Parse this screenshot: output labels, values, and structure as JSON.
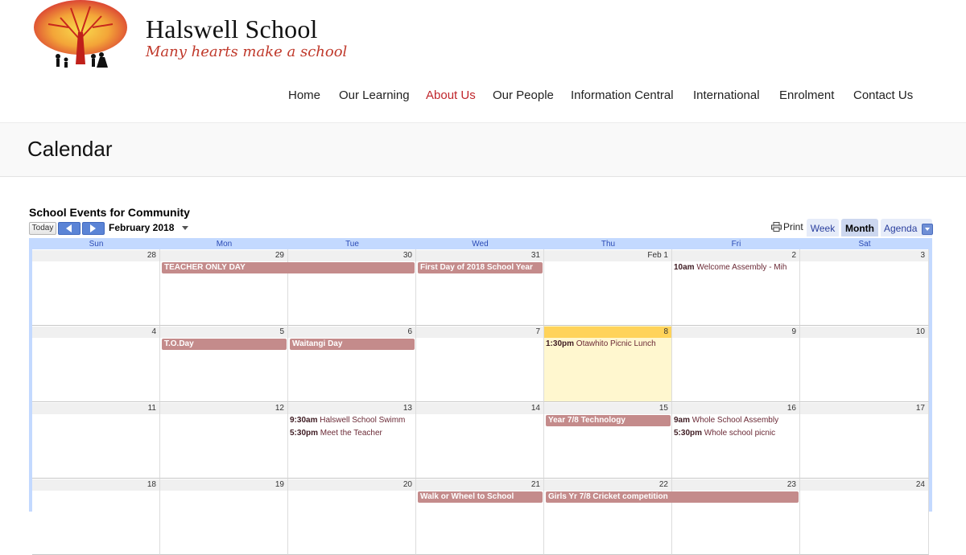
{
  "brand": {
    "name": "Halswell School",
    "tagline": "Many hearts make a school"
  },
  "nav": {
    "items": [
      "Home",
      "Our Learning",
      "About Us",
      "Our People",
      "Information Central",
      "International",
      "Enrolment",
      "Contact Us"
    ],
    "active": "About Us",
    "active_color": "#c0262c"
  },
  "page": {
    "title": "Calendar"
  },
  "calendar": {
    "title": "School Events for Community",
    "today_label": "Today",
    "month_label": "February 2018",
    "print_label": "Print",
    "views": [
      "Week",
      "Month",
      "Agenda"
    ],
    "selected_view": "Month",
    "weekdays": [
      "Sun",
      "Mon",
      "Tue",
      "Wed",
      "Thu",
      "Fri",
      "Sat"
    ],
    "weeks": [
      [
        "28",
        "29",
        "30",
        "31",
        "Feb 1",
        "2",
        "3"
      ],
      [
        "4",
        "5",
        "6",
        "7",
        "8",
        "9",
        "10"
      ],
      [
        "11",
        "12",
        "13",
        "14",
        "15",
        "16",
        "17"
      ],
      [
        "18",
        "19",
        "20",
        "21",
        "22",
        "23",
        "24"
      ]
    ],
    "today_week": 1,
    "today_day": 4,
    "event_color": "#c48b8b",
    "events": [
      {
        "week": 0,
        "day": 1,
        "span": 2,
        "bar": true,
        "title": "TEACHER ONLY DAY"
      },
      {
        "week": 0,
        "day": 3,
        "span": 1,
        "bar": true,
        "title": "First Day of 2018 School Year"
      },
      {
        "week": 0,
        "day": 5,
        "span": 1,
        "row": 0,
        "bar": false,
        "time": "10am",
        "title": "Welcome Assembly - Mih"
      },
      {
        "week": 1,
        "day": 1,
        "span": 1,
        "bar": true,
        "title": "T.O.Day"
      },
      {
        "week": 1,
        "day": 2,
        "span": 1,
        "bar": true,
        "title": "Waitangi Day"
      },
      {
        "week": 1,
        "day": 4,
        "span": 1,
        "row": 0,
        "bar": false,
        "time": "1:30pm",
        "title": "Otawhito Picnic Lunch"
      },
      {
        "week": 2,
        "day": 2,
        "span": 1,
        "row": 0,
        "bar": false,
        "time": "9:30am",
        "title": "Halswell School Swimm"
      },
      {
        "week": 2,
        "day": 2,
        "span": 1,
        "row": 1,
        "bar": false,
        "time": "5:30pm",
        "title": "Meet the Teacher"
      },
      {
        "week": 2,
        "day": 4,
        "span": 1,
        "bar": true,
        "title": "Year 7/8 Technology"
      },
      {
        "week": 2,
        "day": 5,
        "span": 1,
        "row": 0,
        "bar": false,
        "time": "9am",
        "title": "Whole School Assembly"
      },
      {
        "week": 2,
        "day": 5,
        "span": 1,
        "row": 1,
        "bar": false,
        "time": "5:30pm",
        "title": "Whole school picnic"
      },
      {
        "week": 3,
        "day": 3,
        "span": 1,
        "bar": true,
        "title": "Walk or Wheel to School"
      },
      {
        "week": 3,
        "day": 4,
        "span": 2,
        "bar": true,
        "title": "Girls Yr 7/8 Cricket competition"
      }
    ]
  }
}
